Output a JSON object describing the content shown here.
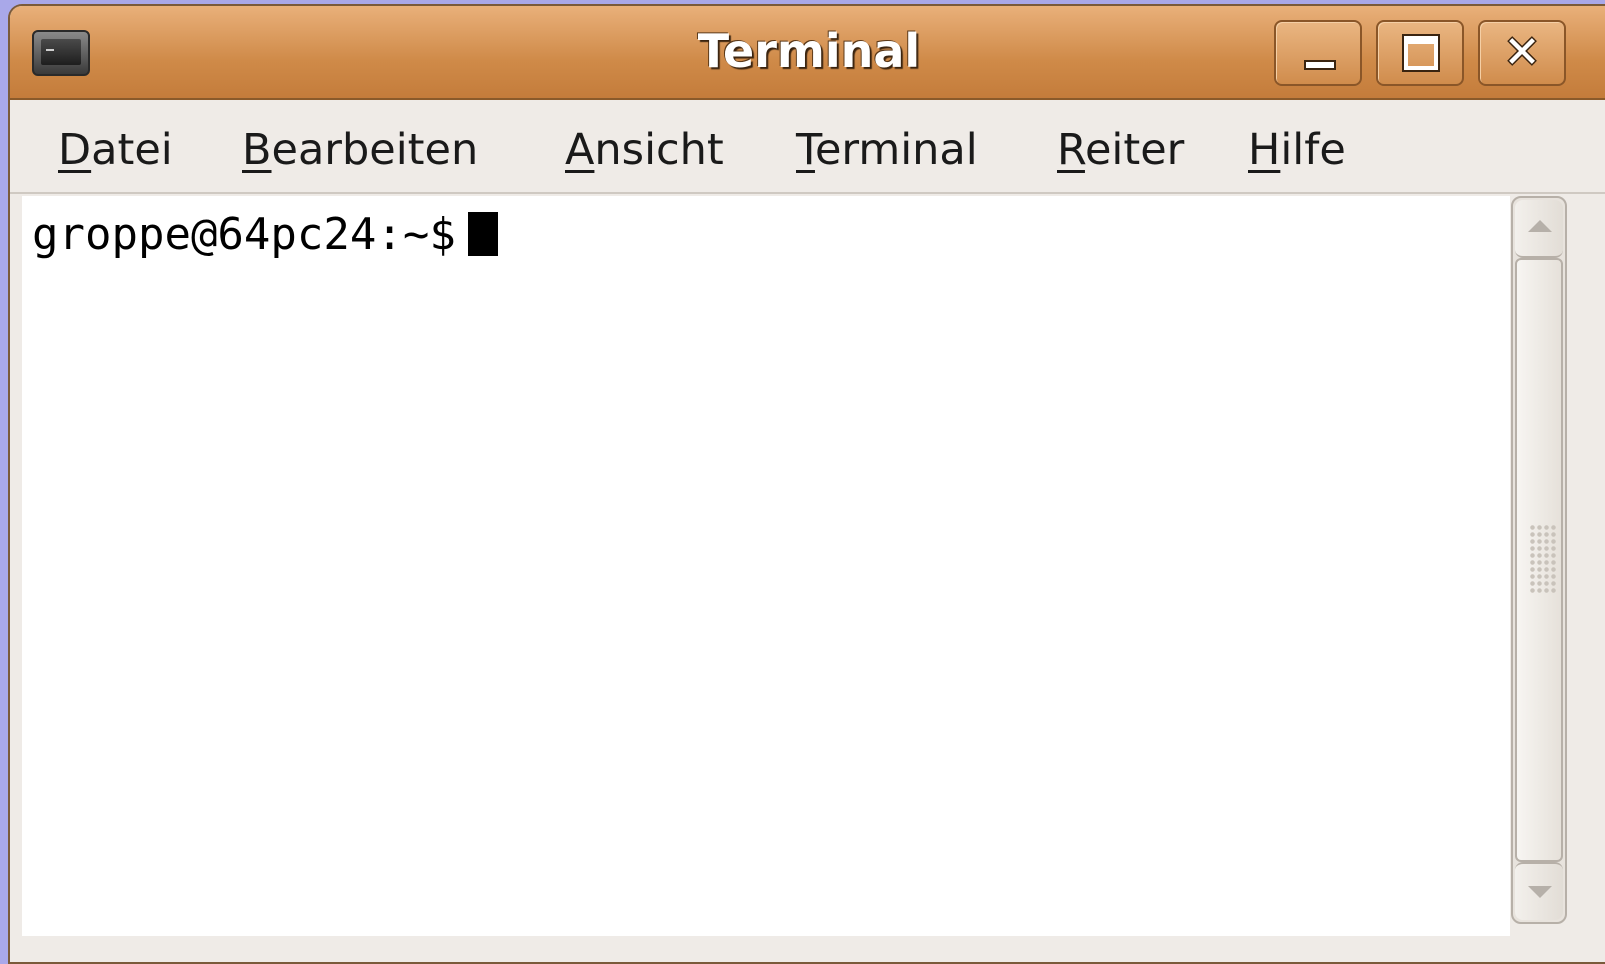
{
  "window": {
    "title": "Terminal"
  },
  "titlebar": {
    "app_icon": "terminal-icon",
    "buttons": {
      "minimize_icon": "minimize-icon",
      "maximize_icon": "maximize-icon",
      "close_icon": "close-icon",
      "close_glyph": "✕"
    }
  },
  "menu": {
    "items": [
      {
        "mnemonic": "D",
        "rest": "atei"
      },
      {
        "mnemonic": "B",
        "rest": "earbeiten"
      },
      {
        "mnemonic": "A",
        "rest": "nsicht"
      },
      {
        "mnemonic": "T",
        "rest": "erminal"
      },
      {
        "mnemonic": "R",
        "rest": "eiter"
      },
      {
        "mnemonic": "H",
        "rest": "ilfe"
      }
    ]
  },
  "terminal": {
    "prompt": "groppe@64pc24:~$"
  },
  "colors": {
    "titlebar": "#d4914f",
    "desktop": "#a9a8e9",
    "menubar": "#efebe7",
    "terminal_bg": "#ffffff",
    "terminal_fg": "#000000"
  }
}
